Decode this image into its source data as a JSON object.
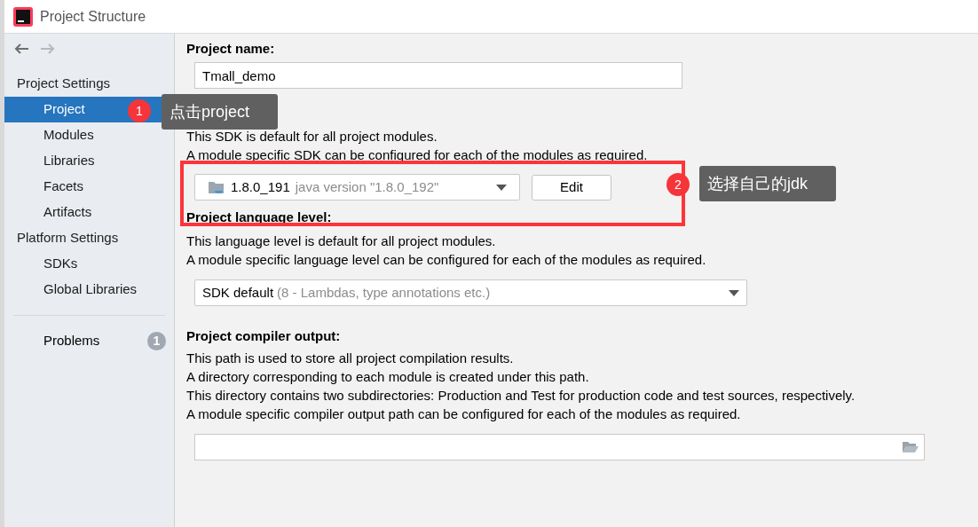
{
  "window": {
    "title": "Project Structure"
  },
  "navigation": [
    {
      "kind": "back",
      "disabled": false
    },
    {
      "kind": "forward",
      "disabled": true
    }
  ],
  "sidebar": {
    "sections": [
      {
        "header": "Project Settings",
        "items": [
          {
            "label": "Project",
            "selected": true
          },
          {
            "label": "Modules",
            "selected": false
          },
          {
            "label": "Libraries",
            "selected": false
          },
          {
            "label": "Facets",
            "selected": false
          },
          {
            "label": "Artifacts",
            "selected": false
          }
        ]
      },
      {
        "header": "Platform Settings",
        "items": [
          {
            "label": "SDKs",
            "selected": false
          },
          {
            "label": "Global Libraries",
            "selected": false
          }
        ]
      }
    ],
    "problems": {
      "label": "Problems",
      "count": "1"
    }
  },
  "project_name": {
    "label": "Project name:",
    "value": "Tmall_demo"
  },
  "project_sdk": {
    "description": [
      "This SDK is default for all project modules.",
      "A module specific SDK can be configured for each of the modules as required."
    ],
    "dropdown": {
      "value": "1.8.0_191",
      "detail": "java version \"1.8.0_192\""
    },
    "edit_button": "Edit"
  },
  "language_level": {
    "label": "Project language level:",
    "description": [
      "This language level is default for all project modules.",
      "A module specific language level can be configured for each of the modules as required."
    ],
    "dropdown": {
      "value": "SDK default",
      "detail": "(8 - Lambdas, type annotations etc.)"
    }
  },
  "compiler_output": {
    "label": "Project compiler output:",
    "description": [
      "This path is used to store all project compilation results.",
      "A directory corresponding to each module is created under this path.",
      "This directory contains two subdirectories: Production and Test for production code and test sources, respectively.",
      "A module specific compiler output path can be configured for each of the modules as required."
    ]
  },
  "annotations": [
    {
      "number": "1",
      "text": "点击project"
    },
    {
      "number": "2",
      "text": "选择自己的jdk"
    }
  ]
}
